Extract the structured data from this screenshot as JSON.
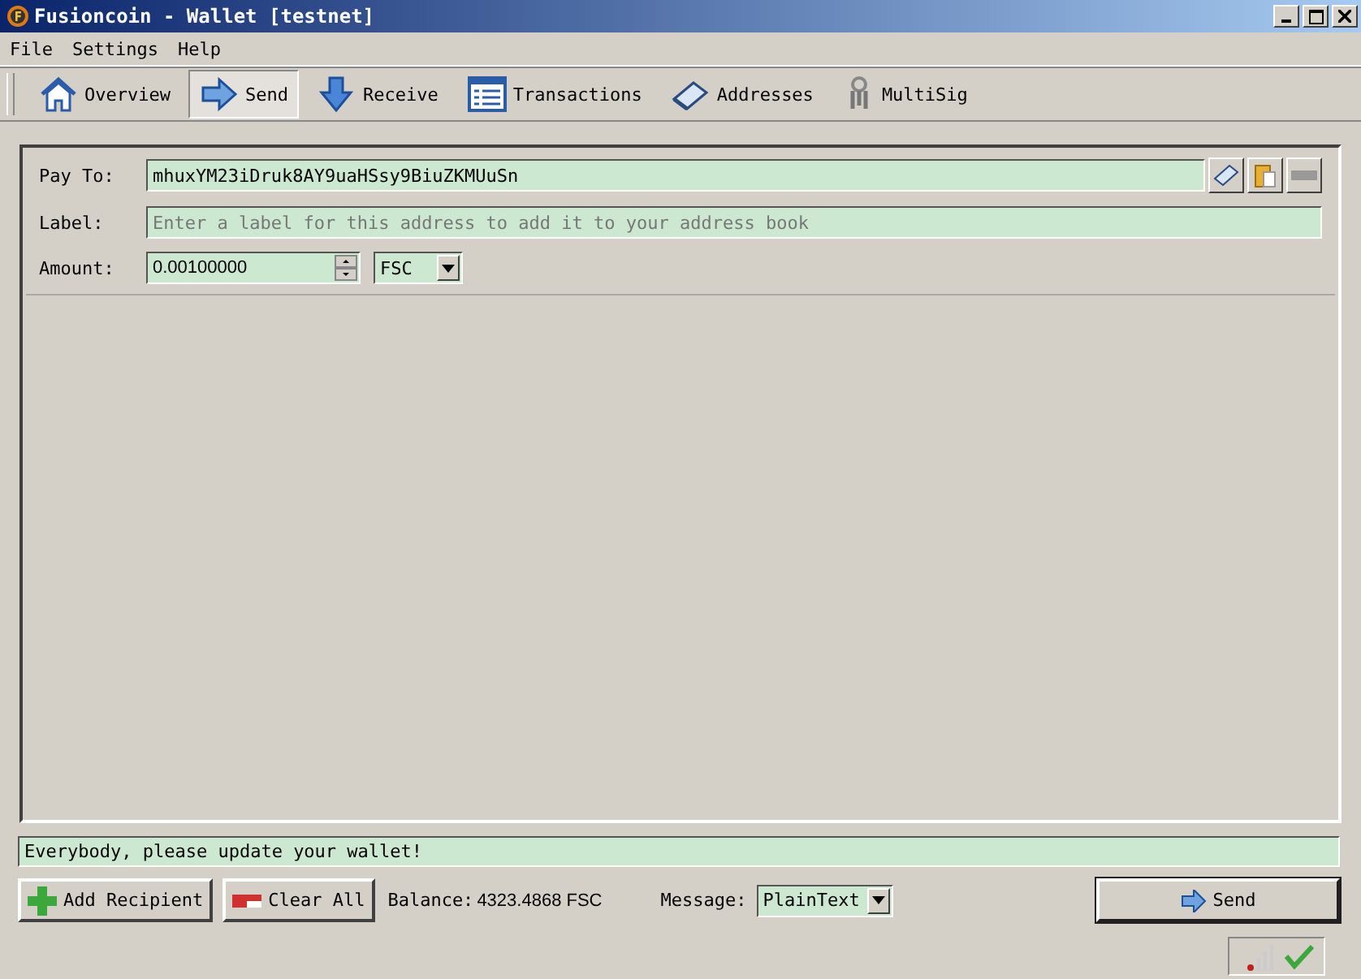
{
  "window": {
    "title": "Fusioncoin - Wallet [testnet]"
  },
  "menu": [
    "File",
    "Settings",
    "Help"
  ],
  "tabs": [
    {
      "label": "Overview",
      "selected": false
    },
    {
      "label": "Send",
      "selected": true
    },
    {
      "label": "Receive",
      "selected": false
    },
    {
      "label": "Transactions",
      "selected": false
    },
    {
      "label": "Addresses",
      "selected": false
    },
    {
      "label": "MultiSig",
      "selected": false
    }
  ],
  "recipient": {
    "pay_to_label": "Pay To:",
    "pay_to_value": "mhuxYM23iDruk8AY9uaHSsy9BiuZKMUuSn",
    "label_label": "Label:",
    "label_placeholder": "Enter a label for this address to add it to your address book",
    "amount_label": "Amount:",
    "amount_value": "0.00100000",
    "unit": "FSC"
  },
  "message_field": {
    "value": "Everybody, please update your wallet!"
  },
  "bottom": {
    "add_recipient": "Add Recipient",
    "clear_all": "Clear All",
    "balance_label": "Balance:",
    "balance_value": "4323.4868 FSC",
    "message_label": "Message:",
    "message_type": "PlainText",
    "send": "Send"
  }
}
